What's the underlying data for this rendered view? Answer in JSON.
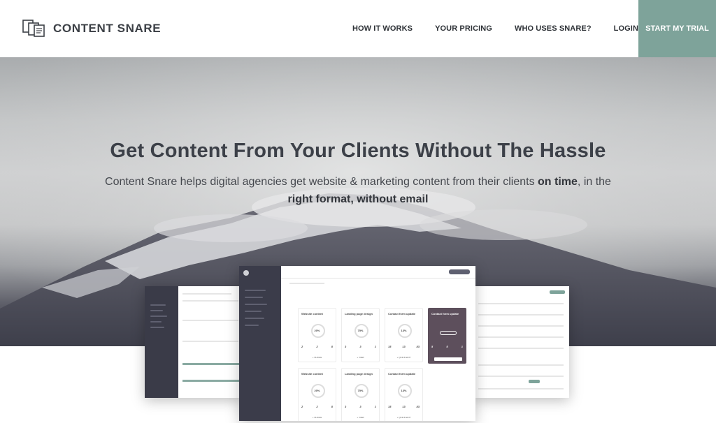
{
  "brand": {
    "name": "CONTENT SNARE"
  },
  "nav": {
    "items": [
      "HOW IT WORKS",
      "YOUR PRICING",
      "WHO USES SNARE?",
      "LOGIN"
    ],
    "cta": "START MY TRIAL"
  },
  "colors": {
    "accent": "#7ea39a",
    "dark_sidebar": "#3b3c4a",
    "highlight_card": "#5d4f5c"
  },
  "hero": {
    "title": "Get Content From Your Clients Without The Hassle",
    "subtitle_prefix": "Content Snare helps digital agencies get website & marketing content from their clients ",
    "subtitle_bold_1": "on time",
    "subtitle_mid": ", in the",
    "subtitle_bold_2": "right format, without email"
  },
  "mockup": {
    "cards": [
      {
        "title": "Website content",
        "percent": "20%",
        "nums": [
          "2",
          "2",
          "8"
        ],
        "action": "+ NUDGE"
      },
      {
        "title": "Landing page design",
        "percent": "75%",
        "nums": [
          "3",
          "3",
          "1"
        ],
        "action": "+ VIEW"
      },
      {
        "title": "Contact form update",
        "percent": "13%",
        "nums": [
          "15",
          "13",
          "83"
        ],
        "action": "+ QUICK EDIT"
      },
      {
        "title": "Contact form update",
        "percent": "",
        "nums": [
          "5",
          "5",
          "1"
        ],
        "action": "",
        "highlight": true
      },
      {
        "title": "Website content",
        "percent": "20%",
        "nums": [
          "2",
          "2",
          "8"
        ],
        "action": "+ NUDGE"
      },
      {
        "title": "Landing page design",
        "percent": "75%",
        "nums": [
          "3",
          "3",
          "1"
        ],
        "action": "+ VIEW"
      },
      {
        "title": "Contact form update",
        "percent": "13%",
        "nums": [
          "15",
          "13",
          "83"
        ],
        "action": "+ QUICK EDIT"
      }
    ]
  }
}
